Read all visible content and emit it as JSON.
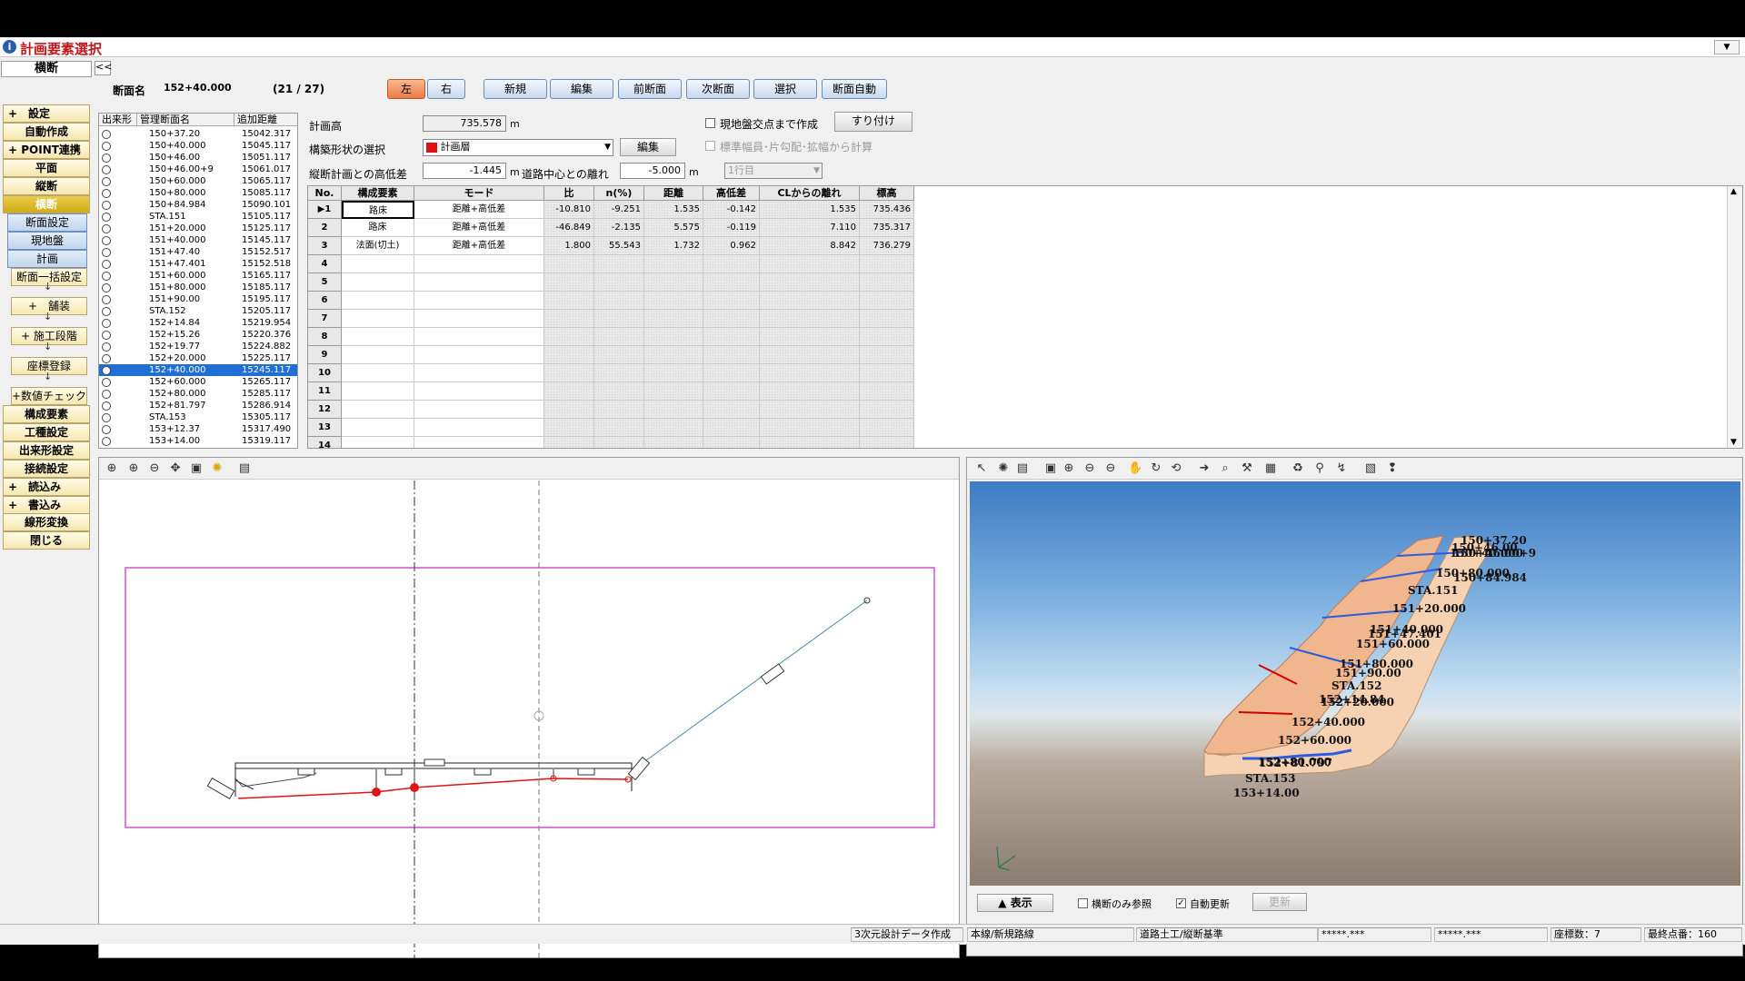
{
  "window": {
    "title": "計画要素選択",
    "icon": "info-icon",
    "dropdown_glyph": "▼"
  },
  "sidebar": {
    "top": "横断",
    "collapse": "<<",
    "items": [
      {
        "label": "+　設定",
        "style": "plus"
      },
      {
        "label": "自動作成",
        "style": "normal"
      },
      {
        "label": "+ POINT連携",
        "style": "plus"
      },
      {
        "label": "平面",
        "style": "normal"
      },
      {
        "label": "縦断",
        "style": "normal"
      },
      {
        "label": "横断",
        "style": "active"
      },
      {
        "label": "断面設定",
        "style": "blue"
      },
      {
        "label": "現地盤",
        "style": "blue"
      },
      {
        "label": "計画",
        "style": "blue"
      },
      {
        "label": "断面一括設定",
        "style": "sub"
      },
      {
        "label": "+　舗装",
        "style": "sub"
      },
      {
        "label": "+ 施工段階",
        "style": "sub"
      },
      {
        "label": "座標登録",
        "style": "sub"
      },
      {
        "label": "+数値チェック",
        "style": "sub"
      },
      {
        "label": "構成要素",
        "style": "normal"
      },
      {
        "label": "工種設定",
        "style": "normal"
      },
      {
        "label": "出来形設定",
        "style": "normal"
      },
      {
        "label": "接続設定",
        "style": "normal"
      },
      {
        "label": "+　読込み",
        "style": "plus"
      },
      {
        "label": "+　書込み",
        "style": "plus"
      },
      {
        "label": "線形変換",
        "style": "normal"
      },
      {
        "label": "閉じる",
        "style": "normal"
      }
    ],
    "arrow": "↓"
  },
  "header": {
    "section_label": "断面名",
    "section_value": "152+40.000",
    "section_count": "(21 / 27)",
    "left": "左",
    "right": "右",
    "buttons": [
      "新規",
      "編集",
      "前断面",
      "次断面",
      "選択",
      "断面自動"
    ]
  },
  "form": {
    "plan_height_label": "計画高",
    "plan_height_value": "735.578",
    "unit_m": "m",
    "shape_label": "構築形状の選択",
    "shape_value": "計画層",
    "shape_edit": "編集",
    "diff_label": "縦断計画との高低差",
    "diff_value": "-1.445",
    "center_label": "道路中心との離れ",
    "center_value": "-5.000",
    "ground_check": "現地盤交点まで作成",
    "suritsuke": "すり付け",
    "std_check": "標準幅員･片勾配･拡幅から計算",
    "row_select": "1行目"
  },
  "list": {
    "headers": [
      "出来形",
      "管理断面名",
      "追加距離"
    ],
    "rows": [
      [
        "150+37.20",
        "15042.317"
      ],
      [
        "150+40.000",
        "15045.117"
      ],
      [
        "150+46.00",
        "15051.117"
      ],
      [
        "150+46.00+9",
        "15061.017"
      ],
      [
        "150+60.000",
        "15065.117"
      ],
      [
        "150+80.000",
        "15085.117"
      ],
      [
        "150+84.984",
        "15090.101"
      ],
      [
        "STA.151",
        "15105.117"
      ],
      [
        "151+20.000",
        "15125.117"
      ],
      [
        "151+40.000",
        "15145.117"
      ],
      [
        "151+47.40",
        "15152.517"
      ],
      [
        "151+47.401",
        "15152.518"
      ],
      [
        "151+60.000",
        "15165.117"
      ],
      [
        "151+80.000",
        "15185.117"
      ],
      [
        "151+90.00",
        "15195.117"
      ],
      [
        "STA.152",
        "15205.117"
      ],
      [
        "152+14.84",
        "15219.954"
      ],
      [
        "152+15.26",
        "15220.376"
      ],
      [
        "152+19.77",
        "15224.882"
      ],
      [
        "152+20.000",
        "15225.117"
      ],
      [
        "152+40.000",
        "15245.117"
      ],
      [
        "152+60.000",
        "15265.117"
      ],
      [
        "152+80.000",
        "15285.117"
      ],
      [
        "152+81.797",
        "15286.914"
      ],
      [
        "STA.153",
        "15305.117"
      ],
      [
        "153+12.37",
        "15317.490"
      ],
      [
        "153+14.00",
        "15319.117"
      ]
    ],
    "selected_index": 20
  },
  "grid": {
    "headers": [
      "No.",
      "構成要素",
      "モード",
      "比",
      "n(%)",
      "距離",
      "高低差",
      "CLからの離れ",
      "標高"
    ],
    "rows": [
      [
        "▶1",
        "路床",
        "距離+高低差",
        "-10.810",
        "-9.251",
        "1.535",
        "-0.142",
        "1.535",
        "735.436"
      ],
      [
        "2",
        "路床",
        "距離+高低差",
        "-46.849",
        "-2.135",
        "5.575",
        "-0.119",
        "7.110",
        "735.317"
      ],
      [
        "3",
        "法面(切土)",
        "距離+高低差",
        "1.800",
        "55.543",
        "1.732",
        "0.962",
        "8.842",
        "736.279"
      ],
      [
        "4",
        "",
        "",
        "",
        "",
        "",
        "",
        "",
        ""
      ],
      [
        "5",
        "",
        "",
        "",
        "",
        "",
        "",
        "",
        ""
      ],
      [
        "6",
        "",
        "",
        "",
        "",
        "",
        "",
        "",
        ""
      ],
      [
        "7",
        "",
        "",
        "",
        "",
        "",
        "",
        "",
        ""
      ],
      [
        "8",
        "",
        "",
        "",
        "",
        "",
        "",
        "",
        ""
      ],
      [
        "9",
        "",
        "",
        "",
        "",
        "",
        "",
        "",
        ""
      ],
      [
        "10",
        "",
        "",
        "",
        "",
        "",
        "",
        "",
        ""
      ],
      [
        "11",
        "",
        "",
        "",
        "",
        "",
        "",
        "",
        ""
      ],
      [
        "12",
        "",
        "",
        "",
        "",
        "",
        "",
        "",
        ""
      ],
      [
        "13",
        "",
        "",
        "",
        "",
        "",
        "",
        "",
        ""
      ],
      [
        "14",
        "",
        "",
        "",
        "",
        "",
        "",
        "",
        ""
      ]
    ]
  },
  "view2d": {
    "toolbar_icons": [
      "zoom-in-icon",
      "zoom-in-alt-icon",
      "zoom-out-icon",
      "pan-icon",
      "fit-icon",
      "light-icon",
      "print-icon"
    ]
  },
  "view3d": {
    "toolbar_icons": [
      "pointer-icon",
      "light-icon",
      "print-icon",
      "fit-icon",
      "zoom-in-icon",
      "zoom-out-icon",
      "zoom-out-alt-icon",
      "hand-icon",
      "rotate-icon",
      "rotate-alt-icon",
      "walk-icon",
      "search-icon",
      "measure-icon",
      "camera-icon",
      "tool-a-icon",
      "tool-b-icon",
      "tool-c-icon",
      "layer-icon",
      "footprint-icon"
    ],
    "labels": [
      "150+37.20",
      "150+46.00",
      "150+46.00+9",
      "150+40.000",
      "150+80.000",
      "150+84.984",
      "STA.151",
      "151+20.000",
      "151+40.000",
      "151+47.401",
      "151+60.000",
      "151+80.000",
      "151+90.00",
      "STA.152",
      "152+14.84",
      "152+20.000",
      "152+40.000",
      "152+60.000",
      "152+80.000",
      "152+81.797",
      "STA.153",
      "153+14.00"
    ],
    "show_btn": "▲ 表示",
    "cross_only": "横断のみ参照",
    "auto_update": "自動更新",
    "update": "更新"
  },
  "status": [
    "3次元設計データ作成",
    "本線/新規路線",
    "道路土工/縦断基準",
    "*****.***",
    "*****.***",
    "座標数：7",
    "最終点番：160"
  ]
}
